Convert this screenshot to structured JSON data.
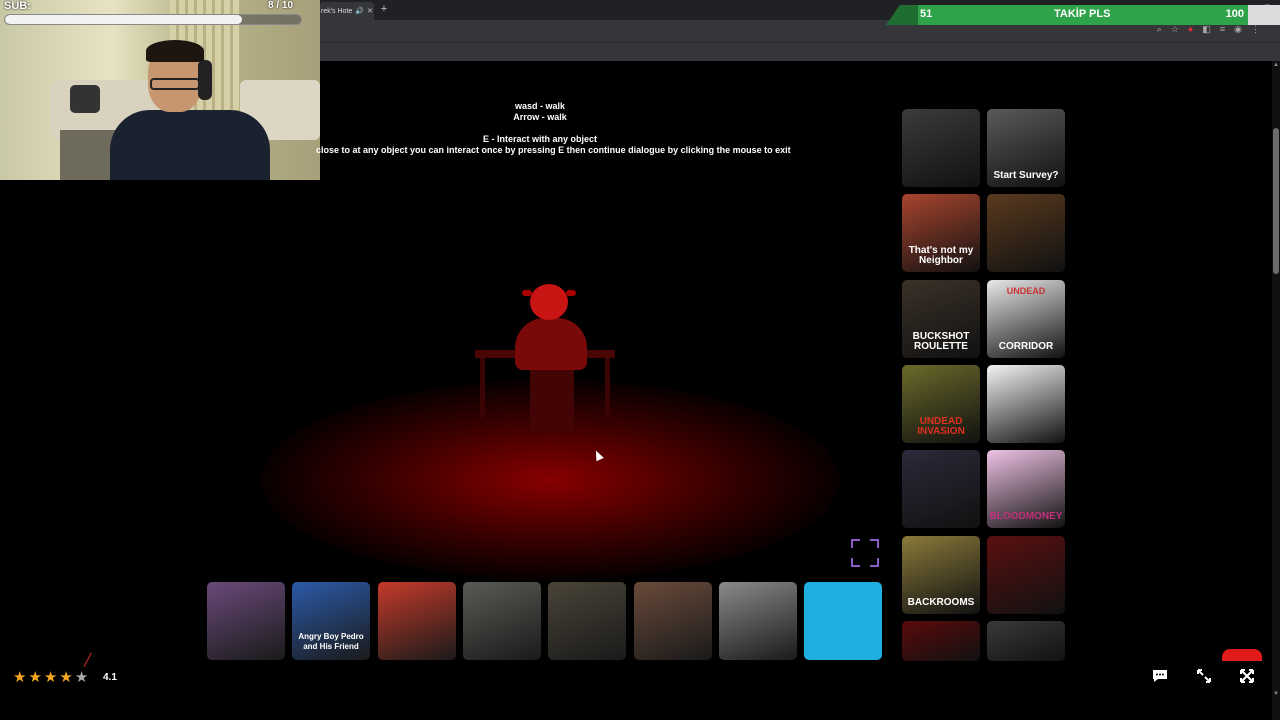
{
  "browser": {
    "tab_title": "rek's Hote",
    "tab_icons": [
      "speaker-icon",
      "close-icon"
    ],
    "new_tab": "+",
    "window_controls": [
      "—",
      "□"
    ]
  },
  "webcam": {
    "sub_label": "SUB:",
    "sub_count": "8 / 10",
    "sub_progress": 0.8
  },
  "follow_banner": {
    "left_value": "51",
    "title": "TAKİP PLS",
    "right_value": "100"
  },
  "game": {
    "instructions": {
      "line1": "wasd - walk",
      "line2": "Arrow -  walk",
      "line3": "E  - Interact with any object",
      "line4": "close to at any object you can interact once by pressing E then continue dialogue by clicking the mouse to exit"
    }
  },
  "side_thumbnails": [
    {
      "name": "granny",
      "label": "",
      "color": "#3b3b3b"
    },
    {
      "name": "start-survey",
      "label": "Start Survey?",
      "color": "#5a5a5a"
    },
    {
      "name": "thats-not-my-neighbor",
      "label": "That's not my Neighbor",
      "color": "#a8452e"
    },
    {
      "name": "freddy",
      "label": "",
      "color": "#5a3a1e"
    },
    {
      "name": "buckshot-roulette",
      "label": "BUCKSHOT ROULETTE",
      "color": "#3b3128"
    },
    {
      "name": "undead-corridor",
      "label": "CORRIDOR",
      "label_top": "UNDEAD",
      "color": "#e8e8e8"
    },
    {
      "name": "undead-invasion",
      "label": "UNDEAD INVASION",
      "color": "#6b6a2a"
    },
    {
      "name": "baldi",
      "label": "",
      "color": "#f4f4f4"
    },
    {
      "name": "anime-girl",
      "label": "",
      "color": "#2a2a3a"
    },
    {
      "name": "bloodmoney",
      "label": "BLOODMONEY",
      "color": "#f0c3e6"
    },
    {
      "name": "backrooms",
      "label": "BACKROOMS",
      "color": "#8a7a3a"
    },
    {
      "name": "fears-sausage",
      "label": "",
      "color": "#5a1010"
    },
    {
      "name": "red-horror",
      "label": "",
      "color": "#5a0a0a"
    },
    {
      "name": "granny-duo",
      "label": "",
      "color": "#3a3a3a"
    }
  ],
  "bottom_thumbnails": [
    {
      "name": "anime-girl-purple",
      "label": "",
      "color": "#6a4a7a"
    },
    {
      "name": "angry-boy-pedro",
      "label": "Angry Boy Pedro and His Friend",
      "color": "#2b5aa8"
    },
    {
      "name": "red-haired-girl",
      "label": "",
      "color": "#c43a2a"
    },
    {
      "name": "office-horror",
      "label": "",
      "color": "#5a5a55"
    },
    {
      "name": "creepy-figure",
      "label": "",
      "color": "#4a4438"
    },
    {
      "name": "zombie-face",
      "label": "",
      "color": "#6a4a3a"
    },
    {
      "name": "foggy-scene",
      "label": "",
      "color": "#8a8a8a"
    },
    {
      "name": "orange-headphones",
      "label": "",
      "color": "#1fb0e0"
    }
  ],
  "rating": {
    "value": 4.1,
    "label": "4.1",
    "max": 5
  },
  "bottom_icons": [
    "comment-icon",
    "expand-icon",
    "fullscreen-icon"
  ]
}
